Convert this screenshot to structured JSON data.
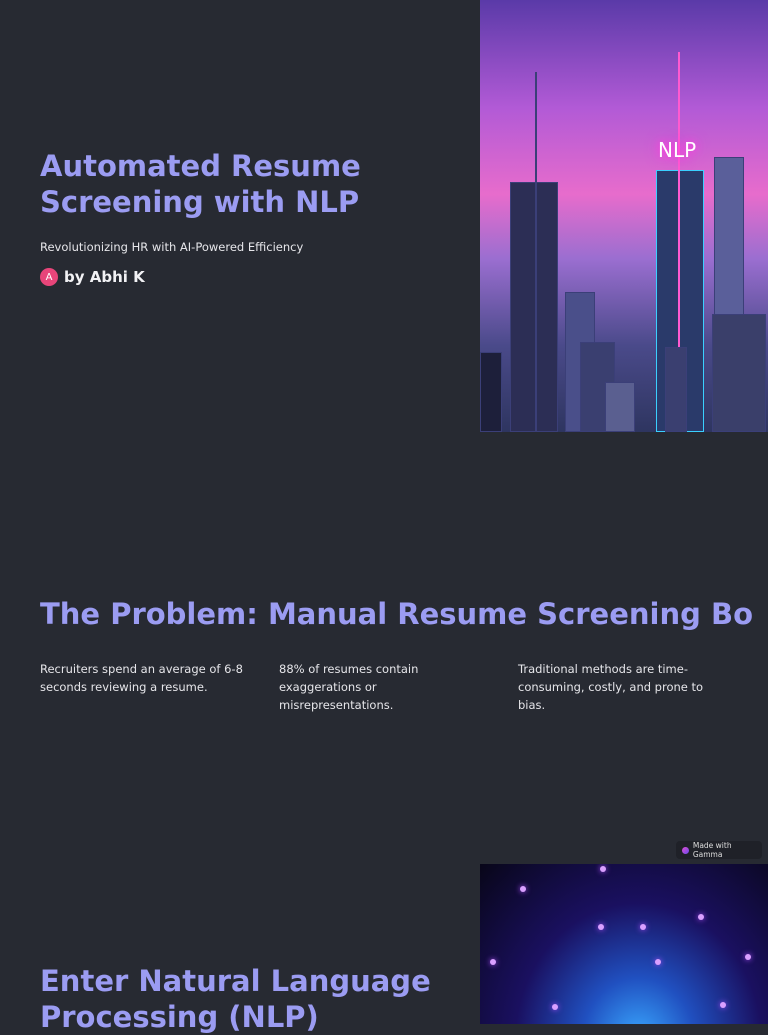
{
  "slide1": {
    "title": "Automated Resume Screening with NLP",
    "subtitle": "Revolutionizing HR with AI-Powered Efficiency",
    "author_initial": "A",
    "author": "by Abhi K",
    "image_sign": "NLP"
  },
  "slide2": {
    "title": "The Problem: Manual Resume Screening Bo",
    "points": [
      "Recruiters spend an average of 6-8 seconds reviewing a resume.",
      "88% of resumes contain exaggerations or misrepresentations.",
      "Traditional methods are time-consuming, costly, and prone to bias."
    ]
  },
  "badge": {
    "label": "Made with Gamma"
  },
  "slide3": {
    "title": "Enter Natural Language Processing (NLP)"
  }
}
